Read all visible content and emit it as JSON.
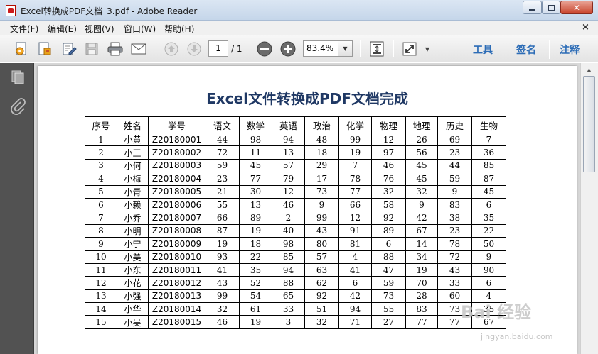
{
  "window": {
    "title": "Excel转换成PDF文档_3.pdf - Adobe Reader"
  },
  "menubar": {
    "items": [
      "文件(F)",
      "编辑(E)",
      "视图(V)",
      "窗口(W)",
      "帮助(H)"
    ],
    "close_glyph": "×"
  },
  "toolbar": {
    "icons": [
      "create-pdf-icon",
      "collaborate-icon",
      "edit-document-icon",
      "save-icon",
      "print-icon",
      "email-icon",
      "page-up-icon",
      "page-down-icon",
      "zoom-out-icon",
      "zoom-in-icon",
      "fit-page-icon",
      "fullscreen-icon"
    ],
    "page_number": "1",
    "page_total": "/ 1",
    "zoom": "83.4%",
    "tools_label": "工具",
    "sign_label": "签名",
    "comment_label": "注释"
  },
  "leftnav": {
    "icons": [
      "pages-icon",
      "attachments-icon"
    ]
  },
  "document": {
    "title": "Excel文件转换成PDF文档完成",
    "table": {
      "headers": [
        "序号",
        "姓名",
        "学号",
        "语文",
        "数学",
        "英语",
        "政治",
        "化学",
        "物理",
        "地理",
        "历史",
        "生物"
      ],
      "rows": [
        [
          "1",
          "小黄",
          "Z20180001",
          "44",
          "98",
          "94",
          "48",
          "99",
          "12",
          "26",
          "69",
          "7"
        ],
        [
          "2",
          "小王",
          "Z20180002",
          "72",
          "11",
          "13",
          "18",
          "19",
          "97",
          "56",
          "23",
          "36"
        ],
        [
          "3",
          "小何",
          "Z20180003",
          "59",
          "45",
          "57",
          "29",
          "7",
          "46",
          "45",
          "44",
          "85"
        ],
        [
          "4",
          "小梅",
          "Z20180004",
          "23",
          "77",
          "79",
          "17",
          "78",
          "76",
          "45",
          "59",
          "87"
        ],
        [
          "5",
          "小青",
          "Z20180005",
          "21",
          "30",
          "12",
          "73",
          "77",
          "32",
          "32",
          "9",
          "45"
        ],
        [
          "6",
          "小赖",
          "Z20180006",
          "55",
          "13",
          "46",
          "9",
          "66",
          "58",
          "9",
          "83",
          "6"
        ],
        [
          "7",
          "小乔",
          "Z20180007",
          "66",
          "89",
          "2",
          "99",
          "12",
          "92",
          "42",
          "38",
          "35"
        ],
        [
          "8",
          "小明",
          "Z20180008",
          "87",
          "19",
          "40",
          "43",
          "91",
          "89",
          "67",
          "23",
          "22"
        ],
        [
          "9",
          "小宁",
          "Z20180009",
          "19",
          "18",
          "98",
          "80",
          "81",
          "6",
          "14",
          "78",
          "50"
        ],
        [
          "10",
          "小美",
          "Z20180010",
          "93",
          "22",
          "85",
          "57",
          "4",
          "88",
          "34",
          "72",
          "9"
        ],
        [
          "11",
          "小东",
          "Z20180011",
          "41",
          "35",
          "94",
          "63",
          "41",
          "47",
          "19",
          "43",
          "90"
        ],
        [
          "12",
          "小花",
          "Z20180012",
          "43",
          "52",
          "88",
          "62",
          "6",
          "59",
          "70",
          "33",
          "6"
        ],
        [
          "13",
          "小强",
          "Z20180013",
          "99",
          "54",
          "65",
          "92",
          "42",
          "73",
          "28",
          "60",
          "4"
        ],
        [
          "14",
          "小华",
          "Z20180014",
          "32",
          "61",
          "33",
          "51",
          "94",
          "55",
          "83",
          "73",
          "35"
        ],
        [
          "15",
          "小吴",
          "Z20180015",
          "46",
          "19",
          "3",
          "32",
          "71",
          "27",
          "77",
          "77",
          "67"
        ]
      ]
    }
  },
  "watermark": {
    "text": "Bai 经验",
    "url": "jingyan.baidu.com"
  },
  "colors": {
    "title_blue": "#1f3864",
    "link_blue": "#2c6cb6",
    "nav_gray": "#525252"
  }
}
